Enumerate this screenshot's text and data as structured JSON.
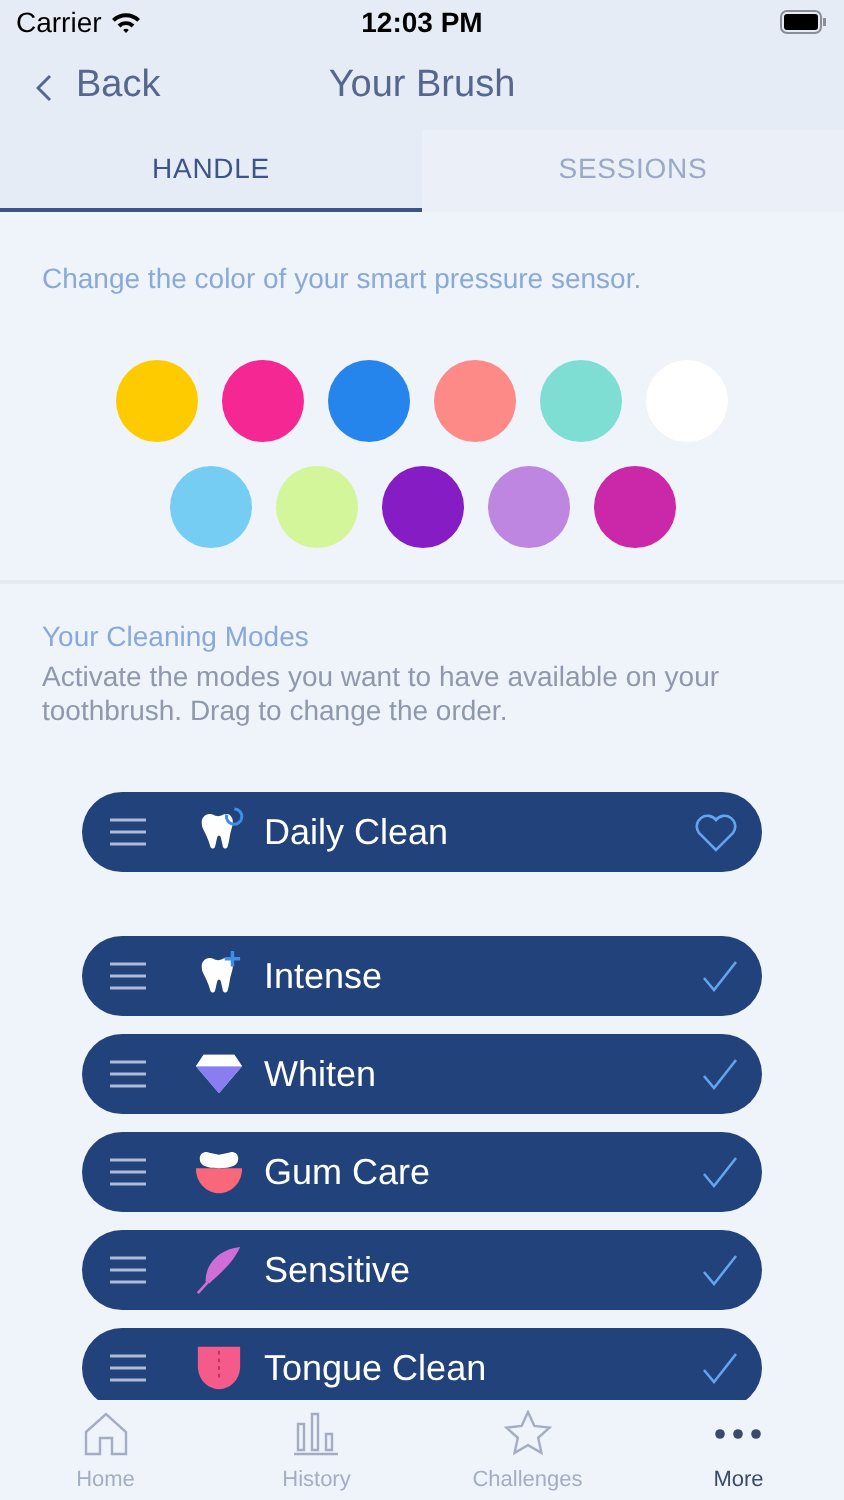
{
  "status_bar": {
    "carrier": "Carrier",
    "time": "12:03 PM"
  },
  "nav": {
    "back": "Back",
    "title": "Your Brush"
  },
  "tabs": [
    {
      "label": "HANDLE",
      "selected": true
    },
    {
      "label": "SESSIONS",
      "selected": false
    }
  ],
  "color_section": {
    "prompt": "Change the color of your smart pressure sensor.",
    "swatches": [
      {
        "color": "#fecb00"
      },
      {
        "color": "#f52792"
      },
      {
        "color": "#2685ec"
      },
      {
        "color": "#fd8a87"
      },
      {
        "color": "#7fded3"
      },
      {
        "color": "#ffffff"
      },
      {
        "color": "#76cdf3"
      },
      {
        "color": "#d3f69a"
      },
      {
        "color": "#861cc4"
      },
      {
        "color": "#be86e0"
      },
      {
        "color": "#cb28a9"
      }
    ]
  },
  "modes_section": {
    "title": "Your Cleaning Modes",
    "description": "Activate the modes you want to have available on your toothbrush. Drag to change the order.",
    "modes": [
      {
        "label": "Daily Clean",
        "kind": "favorite"
      },
      {
        "label": "Intense",
        "kind": "toggle",
        "checked": true
      },
      {
        "label": "Whiten",
        "kind": "toggle",
        "checked": true
      },
      {
        "label": "Gum Care",
        "kind": "toggle",
        "checked": true
      },
      {
        "label": "Sensitive",
        "kind": "toggle",
        "checked": true
      },
      {
        "label": "Tongue Clean",
        "kind": "toggle",
        "checked": true
      }
    ]
  },
  "tab_bar": [
    {
      "label": "Home",
      "selected": false
    },
    {
      "label": "History",
      "selected": false
    },
    {
      "label": "Challenges",
      "selected": false
    },
    {
      "label": "More",
      "selected": true
    }
  ]
}
